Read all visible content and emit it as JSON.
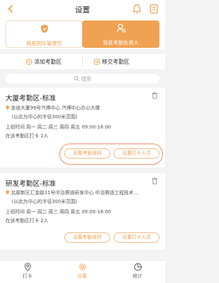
{
  "header": {
    "title": "设置"
  },
  "roles": [
    {
      "label": "我是团队管理员"
    },
    {
      "label": "我是考勤负责人"
    }
  ],
  "actions": {
    "add": "添加考勤区",
    "transfer": "移交考勤区"
  },
  "search": {
    "placeholder": "搜索"
  },
  "areas": [
    {
      "title": "大厦考勤区-标准",
      "address": "金迪大厦99号汽博中心 汽博中心办公大楼",
      "range": "(以此为中心的半径300米范围)",
      "schedule": "上班时间 周一 周二 周三 周四 周五 09:00-18:00",
      "count": "在该考勤区打卡 2人",
      "rule_btn": "设置考勤规则",
      "person_btn": "设置打卡人员"
    },
    {
      "title": "研发考勤区-标准",
      "address": "北部新区汇金路11号中治赛迪研发中心 中治赛迪工程技术...",
      "range": "(以此为中心的半径300米范围)",
      "schedule": "上班时间 周一 周二 周三 周四 周五 09:00-18:00",
      "count": "在该考勤区打卡 2人",
      "rule_btn": "设置考勤规则",
      "person_btn": "设置打卡人员"
    }
  ],
  "tabs": [
    {
      "label": "打卡"
    },
    {
      "label": "设置"
    },
    {
      "label": "统计"
    }
  ],
  "colors": {
    "accent": "#f0a253",
    "highlight": "#f08c6a"
  }
}
